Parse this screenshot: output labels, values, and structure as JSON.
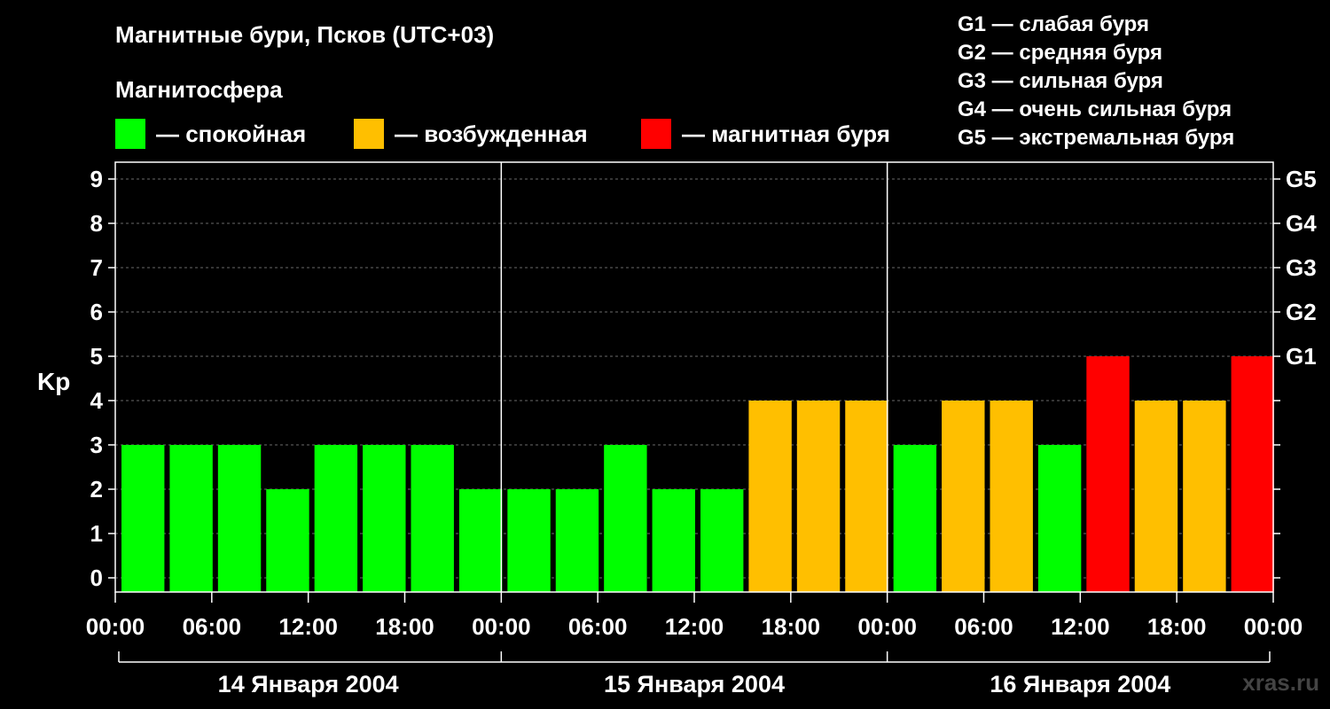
{
  "header": {
    "title": "Магнитные бури, Псков (UTC+03)",
    "magnetosphere_label": "Магнитосфера"
  },
  "legend": [
    {
      "label": "— спокойная",
      "color": "#00ff00"
    },
    {
      "label": "— возбужденная",
      "color": "#ffbf00"
    },
    {
      "label": "— магнитная буря",
      "color": "#ff0000"
    }
  ],
  "g_legend": [
    "G1 — слабая буря",
    "G2 — средняя буря",
    "G3 — сильная буря",
    "G4 — очень сильная буря",
    "G5 — экстремальная буря"
  ],
  "watermark": "xras.ru",
  "chart_data": {
    "type": "bar",
    "ylabel": "Kp",
    "ylim": [
      0,
      9
    ],
    "yticks": [
      "0",
      "1",
      "2",
      "3",
      "4",
      "5",
      "6",
      "7",
      "8",
      "9"
    ],
    "right_ticks": [
      {
        "y": 5,
        "label": "G1"
      },
      {
        "y": 6,
        "label": "G2"
      },
      {
        "y": 7,
        "label": "G3"
      },
      {
        "y": 8,
        "label": "G4"
      },
      {
        "y": 9,
        "label": "G5"
      }
    ],
    "xtick_labels": [
      "00:00",
      "06:00",
      "12:00",
      "18:00",
      "00:00",
      "06:00",
      "12:00",
      "18:00",
      "00:00",
      "06:00",
      "12:00",
      "18:00",
      "00:00"
    ],
    "days": [
      "14 Января 2004",
      "15 Января 2004",
      "16 Января 2004"
    ],
    "values": [
      3,
      3,
      3,
      2,
      3,
      3,
      3,
      2,
      2,
      2,
      3,
      2,
      2,
      4,
      4,
      4,
      3,
      4,
      4,
      3,
      5,
      4,
      4,
      5
    ],
    "colors": {
      "quiet": "#00ff00",
      "active": "#ffbf00",
      "storm": "#ff0000"
    },
    "grid": true
  }
}
